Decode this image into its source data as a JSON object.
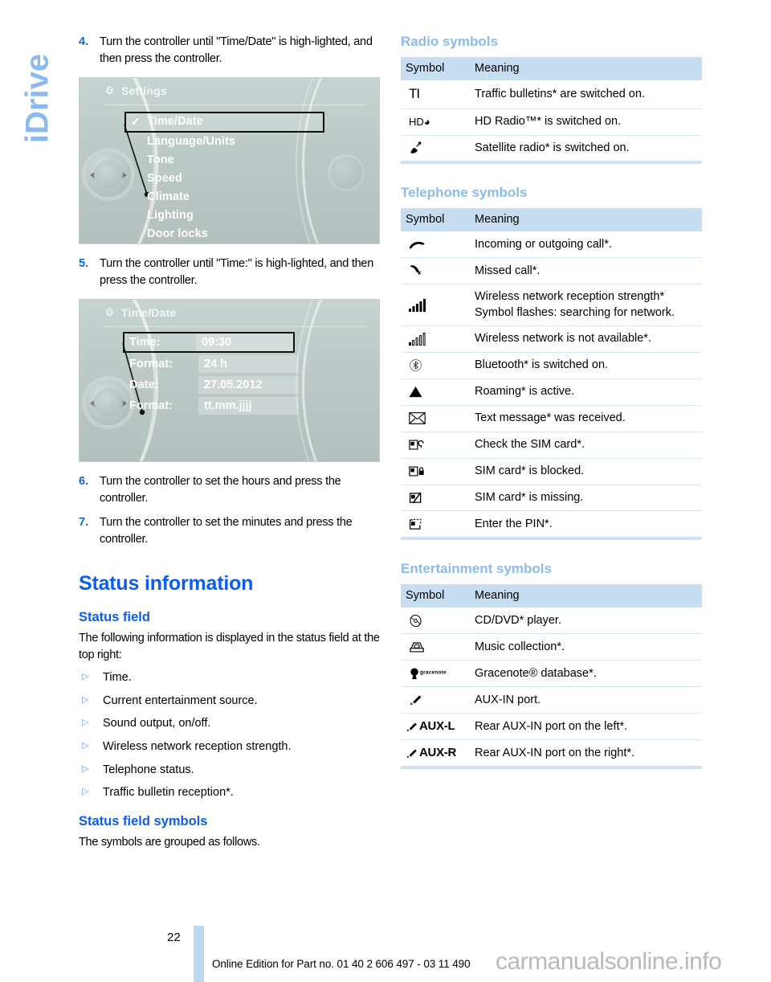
{
  "sidetab": {
    "label": "iDrive"
  },
  "left_column": {
    "steps_top": [
      {
        "num": "4.",
        "text": "Turn the controller until \"Time/Date\" is high-lighted, and then press the controller."
      },
      {
        "num": "5.",
        "text": "Turn the controller until \"Time:\" is high-lighted, and then press the controller."
      }
    ],
    "steps_bottom": [
      {
        "num": "6.",
        "text": "Turn the controller to set the hours and press the controller."
      },
      {
        "num": "7.",
        "text": "Turn the controller to set the minutes and press the controller."
      }
    ],
    "screenshot_settings": {
      "title": "Settings",
      "title_icon": "gear-icon",
      "items": [
        {
          "label": "Time/Date",
          "selected": true,
          "checked": true
        },
        {
          "label": "Language/Units",
          "selected": false,
          "checked": false
        },
        {
          "label": "Tone",
          "selected": false,
          "checked": false
        },
        {
          "label": "Speed",
          "selected": false,
          "checked": false
        },
        {
          "label": "Climate",
          "selected": false,
          "checked": false
        },
        {
          "label": "Lighting",
          "selected": false,
          "checked": false
        },
        {
          "label": "Door locks",
          "selected": false,
          "checked": false
        }
      ]
    },
    "screenshot_timedate": {
      "title": "Time/Date",
      "title_icon": "gear-icon",
      "rows": [
        {
          "label": "Time:",
          "value": "09:30",
          "selected": true
        },
        {
          "label": "Format:",
          "value": "24 h",
          "selected": false
        },
        {
          "label": "Date:",
          "value": "27.05.2012",
          "selected": false
        },
        {
          "label": "Format:",
          "value": "tt.mm.jjjj",
          "selected": false
        }
      ]
    },
    "section_title": "Status information",
    "status_field": {
      "heading": "Status field",
      "intro": "The following information is displayed in the status field at the top right:",
      "bullets": [
        "Time.",
        "Current entertainment source.",
        "Sound output, on/off.",
        "Wireless network reception strength.",
        "Telephone status.",
        "Traffic bulletin reception*."
      ]
    },
    "status_field_symbols": {
      "heading": "Status field symbols",
      "intro": "The symbols are grouped as follows."
    }
  },
  "right_column": {
    "tables": [
      {
        "heading": "Radio symbols",
        "columns": [
          "Symbol",
          "Meaning"
        ],
        "rows": [
          {
            "symbol_name": "traffic-information-icon",
            "symbol_text": "TI",
            "meaning": "Traffic bulletins* are switched on."
          },
          {
            "symbol_name": "hd-radio-icon",
            "symbol_text": "HD",
            "meaning": "HD Radio™* is switched on."
          },
          {
            "symbol_name": "satellite-radio-icon",
            "symbol_text": "",
            "meaning": "Satellite radio* is switched on."
          }
        ]
      },
      {
        "heading": "Telephone symbols",
        "columns": [
          "Symbol",
          "Meaning"
        ],
        "rows": [
          {
            "symbol_name": "handset-call-icon",
            "symbol_text": "",
            "meaning": "Incoming or outgoing call*."
          },
          {
            "symbol_name": "missed-call-icon",
            "symbol_text": "",
            "meaning": "Missed call*."
          },
          {
            "symbol_name": "signal-bars-full-icon",
            "symbol_text": "",
            "meaning": "Wireless network reception strength* Symbol flashes: searching for network."
          },
          {
            "symbol_name": "signal-bars-outline-icon",
            "symbol_text": "",
            "meaning": "Wireless network is not available*."
          },
          {
            "symbol_name": "bluetooth-icon",
            "symbol_text": "",
            "meaning": "Bluetooth* is switched on."
          },
          {
            "symbol_name": "roaming-triangle-icon",
            "symbol_text": "",
            "meaning": "Roaming* is active."
          },
          {
            "symbol_name": "envelope-icon",
            "symbol_text": "",
            "meaning": "Text message* was received."
          },
          {
            "symbol_name": "sim-check-icon",
            "symbol_text": "",
            "meaning": "Check the SIM card*."
          },
          {
            "symbol_name": "sim-locked-icon",
            "symbol_text": "",
            "meaning": "SIM card* is blocked."
          },
          {
            "symbol_name": "sim-missing-icon",
            "symbol_text": "",
            "meaning": "SIM card* is missing."
          },
          {
            "symbol_name": "sim-pin-icon",
            "symbol_text": "",
            "meaning": "Enter the PIN*."
          }
        ]
      },
      {
        "heading": "Entertainment symbols",
        "columns": [
          "Symbol",
          "Meaning"
        ],
        "rows": [
          {
            "symbol_name": "cd-dvd-icon",
            "symbol_text": "",
            "meaning": "CD/DVD* player."
          },
          {
            "symbol_name": "music-collection-icon",
            "symbol_text": "",
            "meaning": "Music collection*."
          },
          {
            "symbol_name": "gracenote-icon",
            "symbol_text": "gracenote",
            "meaning": "Gracenote® database*."
          },
          {
            "symbol_name": "aux-in-plug-icon",
            "symbol_text": "",
            "meaning": "AUX-IN port."
          },
          {
            "symbol_name": "aux-in-left-icon",
            "symbol_text": "AUX-L",
            "meaning": "Rear AUX-IN port on the left*."
          },
          {
            "symbol_name": "aux-in-right-icon",
            "symbol_text": "AUX-R",
            "meaning": "Rear AUX-IN port on the right*."
          }
        ]
      }
    ]
  },
  "footer": {
    "page_number": "22",
    "note": "Online Edition for Part no. 01 40 2 606 497 - 03 11 490",
    "watermark": "carmanualsonline.info"
  },
  "colors": {
    "heading_blue": "#0b5ef0",
    "light_blue": "#8cbaef",
    "table_header_bg": "#c6ddf2",
    "row_rule": "#d9e8f6",
    "footer_bar": "#bdd7f0"
  }
}
